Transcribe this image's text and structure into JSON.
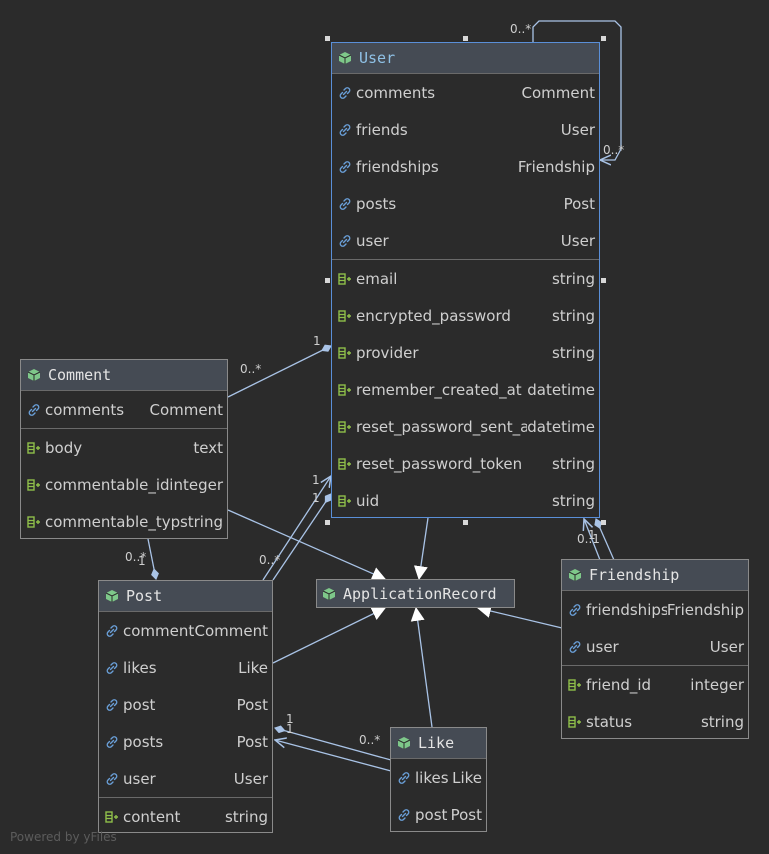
{
  "colors": {
    "background": "#2b2b2b",
    "header": "#454b54",
    "edge": "#a9c3e6",
    "cube": "#7ec88a",
    "link_icon": "#6a9fd8",
    "field_icon": "#8fbf4a"
  },
  "user": {
    "title": "User",
    "rows": [
      {
        "name": "comments",
        "type": "Comment",
        "icon": "link-icon"
      },
      {
        "name": "friends",
        "type": "User",
        "icon": "link-icon"
      },
      {
        "name": "friendships",
        "type": "Friendship",
        "icon": "link-icon"
      },
      {
        "name": "posts",
        "type": "Post",
        "icon": "link-icon"
      },
      {
        "name": "user",
        "type": "User",
        "icon": "link-icon"
      },
      {
        "name": "email",
        "type": "string",
        "icon": "field-icon"
      },
      {
        "name": "encrypted_password",
        "type": "string",
        "icon": "field-icon"
      },
      {
        "name": "provider",
        "type": "string",
        "icon": "field-icon"
      },
      {
        "name": "remember_created_at",
        "type": "datetime",
        "icon": "field-icon"
      },
      {
        "name": "reset_password_sent_at",
        "type": "datetime",
        "icon": "field-icon"
      },
      {
        "name": "reset_password_token",
        "type": "string",
        "icon": "field-icon"
      },
      {
        "name": "uid",
        "type": "string",
        "icon": "field-icon"
      }
    ]
  },
  "comment": {
    "title": "Comment",
    "rows": [
      {
        "name": "comments",
        "type": "Comment",
        "icon": "link-icon"
      },
      {
        "name": "body",
        "type": "text",
        "icon": "field-icon"
      },
      {
        "name": "commentable_id",
        "type": "integer",
        "icon": "field-icon"
      },
      {
        "name": "commentable_type",
        "type": "string",
        "icon": "field-icon"
      }
    ]
  },
  "post": {
    "title": "Post",
    "rows": [
      {
        "name": "comments",
        "type": "Comment",
        "icon": "link-icon"
      },
      {
        "name": "likes",
        "type": "Like",
        "icon": "link-icon"
      },
      {
        "name": "post",
        "type": "Post",
        "icon": "link-icon"
      },
      {
        "name": "posts",
        "type": "Post",
        "icon": "link-icon"
      },
      {
        "name": "user",
        "type": "User",
        "icon": "link-icon"
      },
      {
        "name": "content",
        "type": "string",
        "icon": "field-icon"
      }
    ]
  },
  "friendship": {
    "title": "Friendship",
    "rows": [
      {
        "name": "friendships",
        "type": "Friendship",
        "icon": "link-icon"
      },
      {
        "name": "user",
        "type": "User",
        "icon": "link-icon"
      },
      {
        "name": "friend_id",
        "type": "integer",
        "icon": "field-icon"
      },
      {
        "name": "status",
        "type": "string",
        "icon": "field-icon"
      }
    ]
  },
  "like": {
    "title": "Like",
    "rows": [
      {
        "name": "likes",
        "type": "Like",
        "icon": "link-icon"
      },
      {
        "name": "post",
        "type": "Post",
        "icon": "link-icon"
      }
    ]
  },
  "application_record": {
    "title": "ApplicationRecord"
  },
  "multiplicities": {
    "zero_many": "0..*",
    "one": "1",
    "zero_one": "0..1"
  },
  "footer": "Powered by yFiles"
}
